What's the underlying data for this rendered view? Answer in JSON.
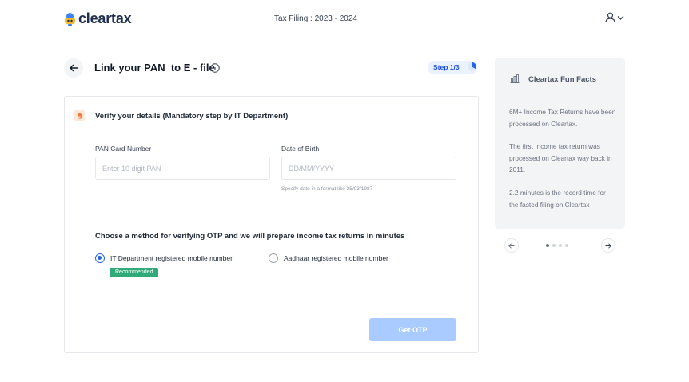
{
  "header": {
    "logo_text": "cleartax",
    "title": "Tax Filing : 2023 - 2024"
  },
  "page": {
    "title": "Link your PAN  to E - file",
    "step": "Step 1/3",
    "step_progress": 0.333
  },
  "verify": {
    "title": "Verify your details (Mandatory step by IT Department)",
    "pan_label": "PAN Card Number",
    "pan_value": "",
    "pan_placeholder": "Enter 10 digit PAN",
    "dob_label": "Date of Birth",
    "dob_value": "",
    "dob_placeholder": "DD/MM/YYYY",
    "dob_hint": "Specify date in a format like 25/03/1987"
  },
  "otp": {
    "title": "Choose a method for verifying OTP and we will prepare income tax returns in minutes",
    "option_it": "IT Department registered mobile number",
    "option_aadhaar": "Aadhaar registered mobile number",
    "selected": "it",
    "recommended_badge": "Recommended",
    "button_label": "Get OTP"
  },
  "facts": {
    "title": "Cleartax Fun Facts",
    "items": [
      "6M+ Income Tax Returns have been processed on Cleartax.",
      "The first Income tax return was processed on Cleartax way back in 2011.",
      "2.2 minutes is the record time for the fasted filing on Cleartax"
    ],
    "carousel_pages": 4,
    "carousel_active": 1
  },
  "colors": {
    "primary": "#2563eb",
    "button_disabled": "#a9cbff",
    "badge": "#2faa78",
    "logo_text": "#1f2f4d"
  },
  "icons": {
    "logo": "cleartax-logo-icon",
    "user": "user-icon",
    "chevron": "chevron-down-icon",
    "back": "arrow-left-icon",
    "info": "info-icon",
    "progress": "progress-ring-icon",
    "document": "document-icon",
    "facts": "bar-chart-icon",
    "prev": "arrow-left-icon",
    "next": "arrow-right-icon"
  }
}
